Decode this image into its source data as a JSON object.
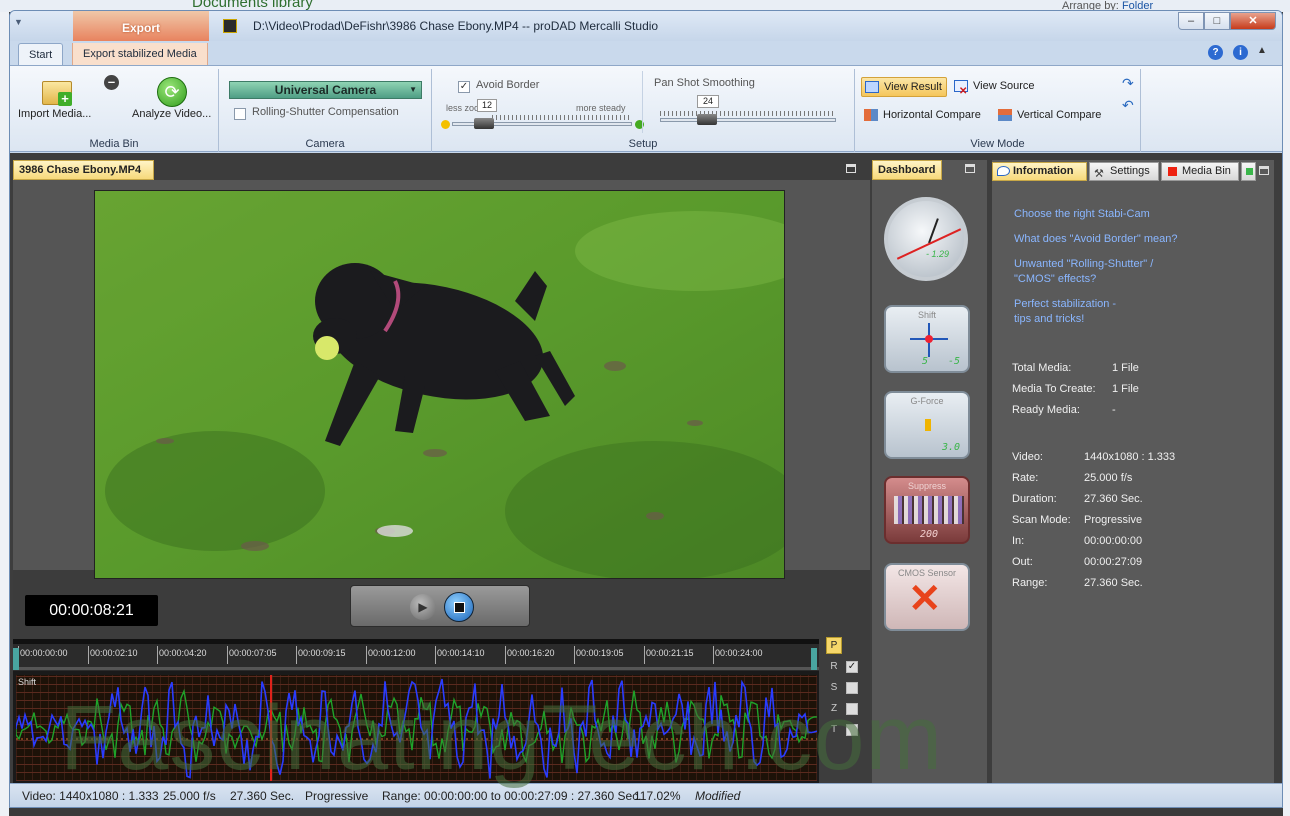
{
  "background": {
    "library_title": "Documents library",
    "arrange_label": "Arrange by:",
    "arrange_value": "Folder"
  },
  "window": {
    "title": "D:\\Video\\Prodad\\DeFishr\\3986 Chase Ebony.MP4 -- proDAD Mercalli Studio",
    "minimize": "–",
    "maximize": "□",
    "close": "✕"
  },
  "ribbon": {
    "context_tab": "Export",
    "tabs": [
      {
        "label": "Start",
        "active": true
      },
      {
        "label": "Export stabilized Media",
        "active": false
      }
    ],
    "media_bin": {
      "label": "Media Bin",
      "import_label": "Import Media...",
      "analyze_label": "Analyze Video..."
    },
    "camera": {
      "label": "Camera",
      "selected": "Universal Camera",
      "rolling_shutter_label": "Rolling-Shutter Compensation",
      "rolling_shutter_checked": false
    },
    "setup": {
      "label": "Setup",
      "avoid_border_label": "Avoid Border",
      "avoid_border_checked": true,
      "avoid_border_value": "12",
      "less_label": "less zoom",
      "more_label": "more steady",
      "pan_label": "Pan Shot Smoothing",
      "pan_value": "24"
    },
    "view_mode": {
      "label": "View Mode",
      "view_result": "View Result",
      "view_source": "View Source",
      "horizontal_compare": "Horizontal Compare",
      "vertical_compare": "Vertical Compare",
      "active": "View Result"
    }
  },
  "video_panel": {
    "tab_label": "3986 Chase Ebony.MP4",
    "timecode": "00:00:08:21"
  },
  "timeline": {
    "ticks": [
      "00:00:00:00",
      "00:00:02:10",
      "00:00:04:20",
      "00:00:07:05",
      "00:00:09:15",
      "00:00:12:00",
      "00:00:14:10",
      "00:00:16:20",
      "00:00:19:05",
      "00:00:21:15",
      "00:00:24:00"
    ],
    "graph_label": "Shift",
    "presets": {
      "p": "P",
      "rows": [
        {
          "label": "R",
          "checked": true
        },
        {
          "label": "S",
          "checked": false
        },
        {
          "label": "Z",
          "checked": false
        },
        {
          "label": "T",
          "checked": false
        }
      ]
    }
  },
  "dashboard": {
    "tab_label": "Dashboard",
    "clock_value": "- 1.29",
    "shift_title": "Shift",
    "shift_value_x": "5",
    "shift_value_y": "-5",
    "gforce_title": "G-Force",
    "gforce_value": "3.0",
    "suppress_title": "Suppress",
    "suppress_value": "200",
    "cmos_title": "CMOS Sensor"
  },
  "info_panel": {
    "tabs": {
      "information": "Information",
      "settings": "Settings",
      "media_bin": "Media Bin"
    },
    "links": [
      "Choose the right Stabi-Cam",
      "What does \"Avoid Border\" mean?",
      "Unwanted \"Rolling-Shutter\" /",
      "\"CMOS\" effects?",
      "Perfect stabilization -",
      "tips and tricks!"
    ],
    "summary": [
      {
        "k": "Total Media:",
        "v": "1 File"
      },
      {
        "k": "Media To Create:",
        "v": "1 File"
      },
      {
        "k": "Ready Media:",
        "v": "-"
      }
    ],
    "details": [
      {
        "k": "Video:",
        "v": "1440x1080 : 1.333"
      },
      {
        "k": "Rate:",
        "v": "25.000 f/s"
      },
      {
        "k": "Duration:",
        "v": "27.360 Sec."
      },
      {
        "k": "Scan Mode:",
        "v": "Progressive"
      },
      {
        "k": "In:",
        "v": "00:00:00:00"
      },
      {
        "k": "Out:",
        "v": "00:00:27:09"
      },
      {
        "k": "Range:",
        "v": "27.360 Sec."
      }
    ]
  },
  "status_bar": {
    "video": "Video: 1440x1080 : 1.333",
    "rate": "25.000 f/s",
    "duration": "27.360 Sec.",
    "scan": "Progressive",
    "range": "Range: 00:00:00:00 to 00:00:27:09 : 27.360 Sec.",
    "zoom": "117.02%",
    "state": "Modified"
  },
  "watermark": "FascinatingTech.com",
  "colors": {
    "accent_yellow": "#f7d97b",
    "export_orange": "#e8835f",
    "link_blue": "#8ab6ff",
    "graph_blue": "#2a3cff",
    "graph_green": "#1fa32a"
  }
}
